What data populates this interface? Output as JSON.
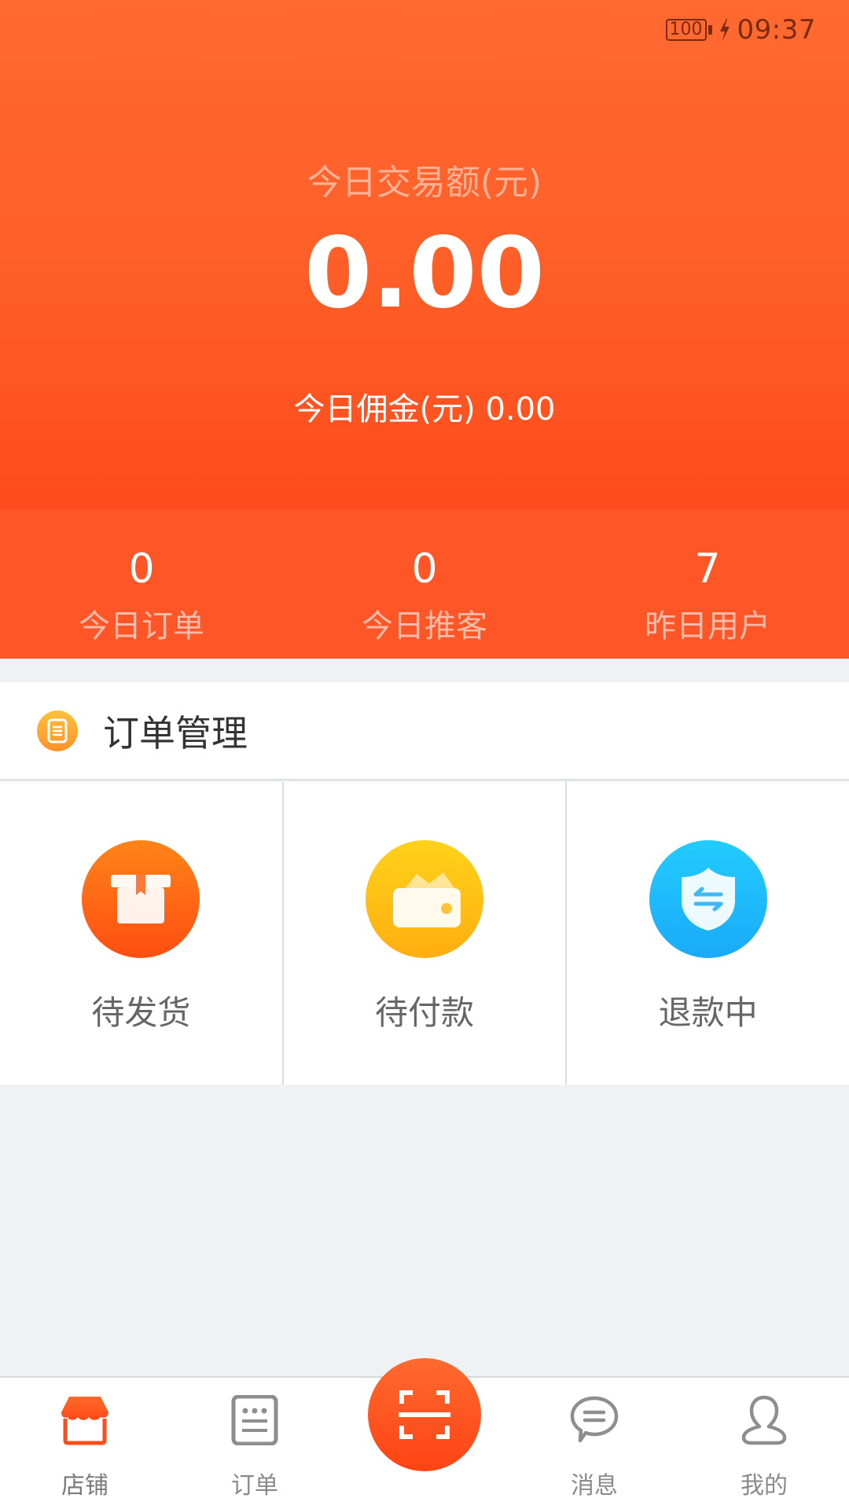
{
  "status_bar": {
    "battery_level": "100",
    "charging": true,
    "time": "09:37"
  },
  "header": {
    "trade_label": "今日交易额(元)",
    "trade_amount": "0.00",
    "commission_label": "今日佣金(元)",
    "commission_value": "0.00"
  },
  "stats": [
    {
      "value": "0",
      "label": "今日订单"
    },
    {
      "value": "0",
      "label": "今日推客"
    },
    {
      "value": "7",
      "label": "昨日用户"
    }
  ],
  "order_section": {
    "title": "订单管理",
    "icon": "document-icon",
    "items": [
      {
        "label": "待发货",
        "icon": "package-box-icon",
        "color": "#FF6A18"
      },
      {
        "label": "待付款",
        "icon": "wallet-icon",
        "color": "#FFC116"
      },
      {
        "label": "退款中",
        "icon": "shield-exchange-icon",
        "color": "#1FBCFC"
      }
    ]
  },
  "bottom_nav": {
    "items": [
      {
        "label": "店铺",
        "icon": "store-icon",
        "active": true
      },
      {
        "label": "订单",
        "icon": "order-list-icon",
        "active": false
      },
      {
        "label": "消息",
        "icon": "chat-bubble-icon",
        "active": false
      },
      {
        "label": "我的",
        "icon": "user-icon",
        "active": false
      }
    ],
    "scan_icon": "scan-icon"
  },
  "colors": {
    "brand": "#FF5628",
    "accent_orange": "#FF6A18",
    "nav_inactive": "#8A8A8A",
    "page_background": "#EEF2F5"
  }
}
